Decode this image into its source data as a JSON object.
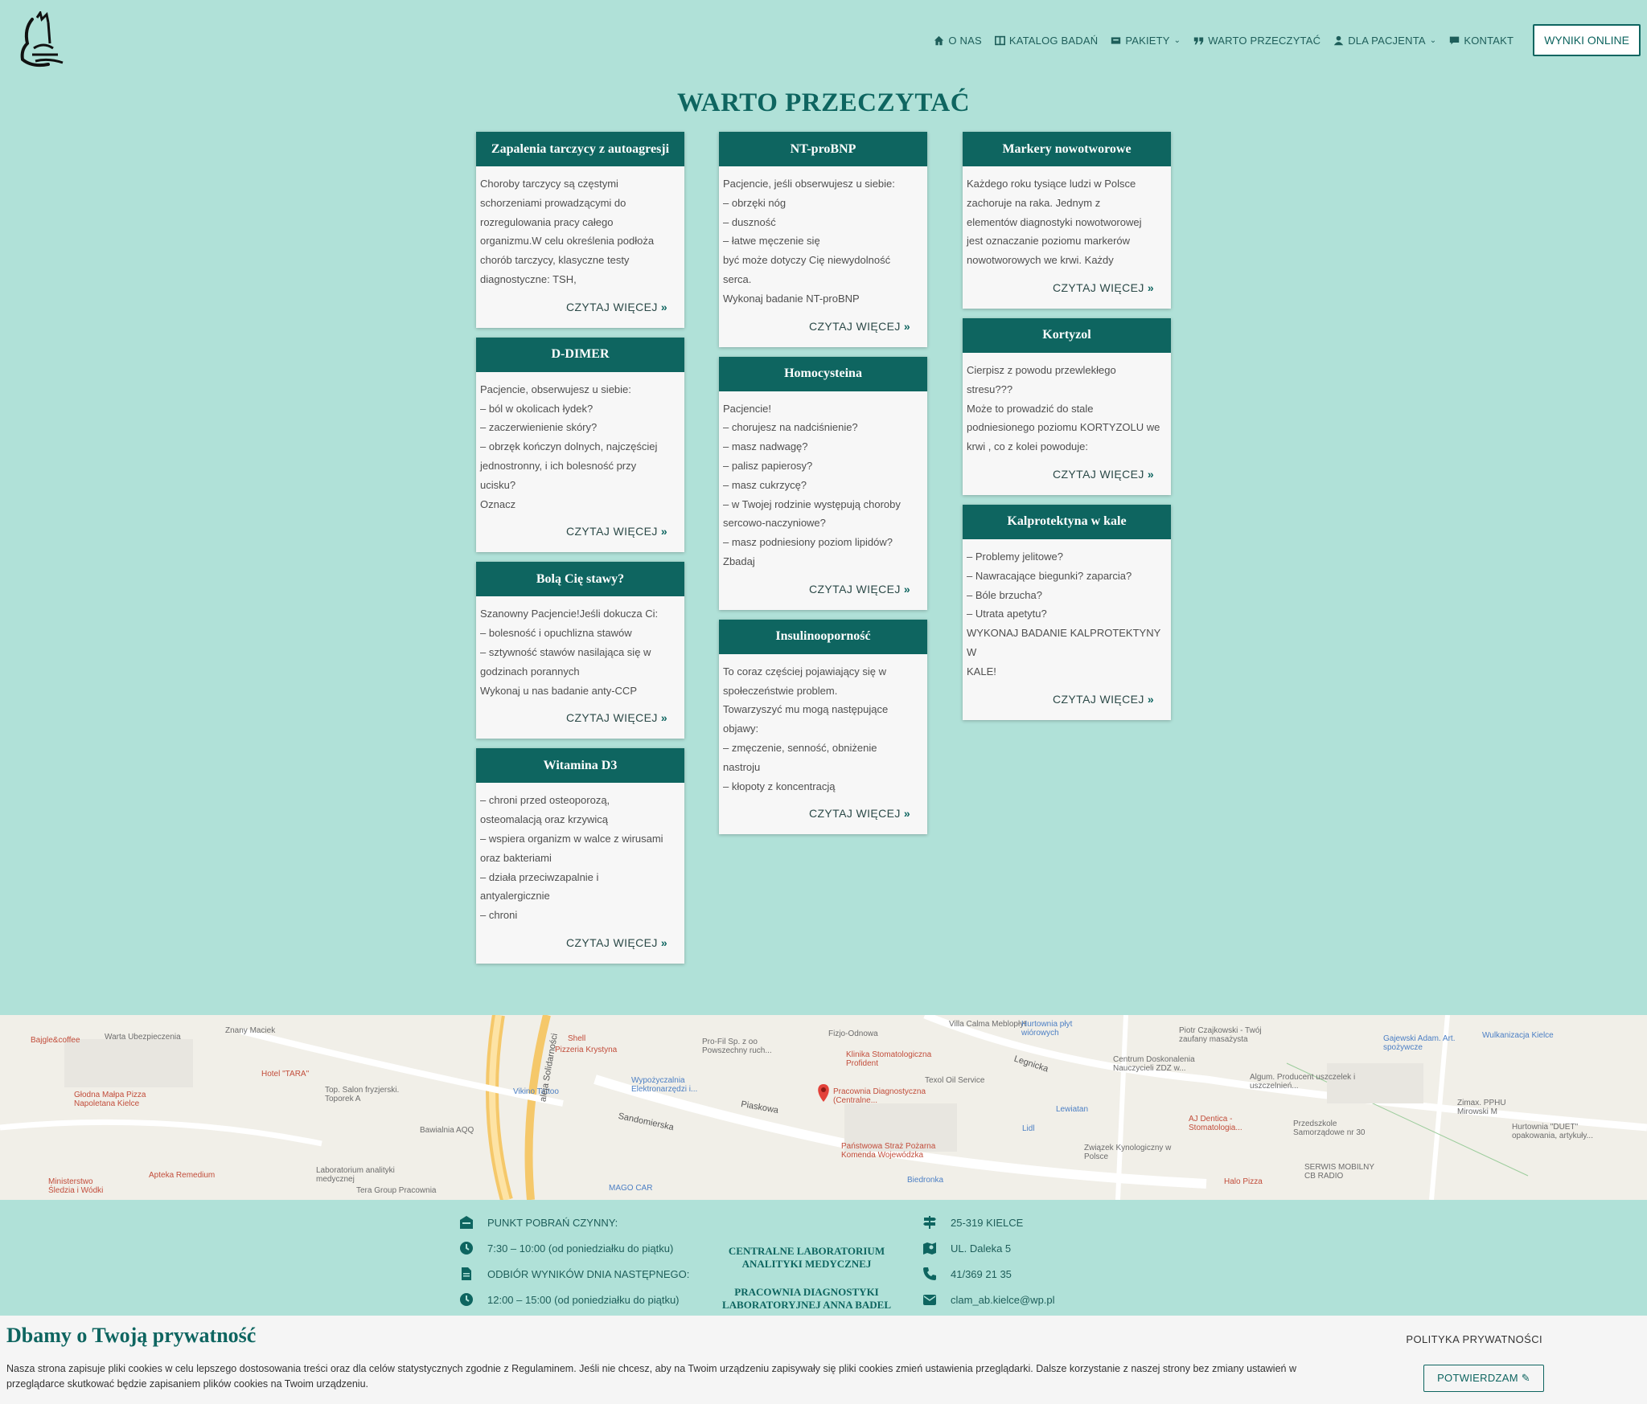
{
  "header": {
    "nav": [
      {
        "label": "O NAS",
        "icon": "home-icon"
      },
      {
        "label": "KATALOG BADAŃ",
        "icon": "book-icon"
      },
      {
        "label": "PAKIETY",
        "icon": "package-icon",
        "dropdown": true
      },
      {
        "label": "WARTO PRZECZYTAĆ",
        "icon": "quote-icon"
      },
      {
        "label": "DLA PACJENTA",
        "icon": "user-icon",
        "dropdown": true
      },
      {
        "label": "KONTAKT",
        "icon": "chat-icon"
      }
    ],
    "results_button": "WYNIKI ONLINE"
  },
  "page_title": "WARTO PRZECZYTAĆ",
  "read_more": "CZYTAJ WIĘCEJ",
  "columns": [
    [
      {
        "title": "Zapalenia tarczycy z autoagresji",
        "lines": [
          "Choroby tarczycy są częstymi",
          "schorzeniami prowadzącymi do",
          "rozregulowania pracy całego",
          "organizmu.W celu określenia podłoża",
          "chorób tarczycy, klasyczne testy",
          "diagnostyczne: TSH,"
        ]
      },
      {
        "title": "D-DIMER",
        "lines": [
          "Pacjencie, obserwujesz u siebie:",
          "– ból w okolicach łydek?",
          "– zaczerwienienie skóry?",
          "– obrzęk kończyn dolnych, najczęściej",
          "jednostronny, i ich bolesność przy",
          "ucisku?",
          "Oznacz"
        ]
      },
      {
        "title": "Bolą Cię stawy?",
        "lines": [
          "Szanowny Pacjencie!Jeśli dokucza Ci:",
          "– bolesność i opuchlizna stawów",
          "– sztywność stawów nasilająca się w",
          "godzinach porannych",
          "Wykonaj u nas badanie anty-CCP"
        ]
      },
      {
        "title": "Witamina D3",
        "lines": [
          "– chroni przed osteoporozą,",
          "osteomalacją oraz krzywicą",
          "– wspiera organizm w walce z wirusami",
          "oraz bakteriami",
          "– działa przeciwzapalnie i",
          "antyalergicznie",
          "– chroni"
        ]
      }
    ],
    [
      {
        "title": "NT-proBNP",
        "lines": [
          "Pacjencie, jeśli obserwujesz u siebie:",
          "– obrzęki nóg",
          "– duszność",
          "– łatwe męczenie się",
          "być może dotyczy Cię niewydolność",
          "serca.",
          "Wykonaj badanie NT-proBNP"
        ]
      },
      {
        "title": "Homocysteina",
        "lines": [
          "Pacjencie!",
          "– chorujesz na nadciśnienie?",
          "– masz nadwagę?",
          "– palisz papierosy?",
          "– masz cukrzycę?",
          "– w Twojej rodzinie występują choroby",
          "sercowo-naczyniowe?",
          "– masz podniesiony poziom lipidów?",
          "Zbadaj"
        ]
      },
      {
        "title": "Insulinooporność",
        "lines": [
          "To coraz częściej pojawiający się w",
          "społeczeństwie problem.",
          "Towarzyszyć mu mogą następujące",
          "objawy:",
          "– zmęczenie, senność, obniżenie",
          "nastroju",
          "– kłopoty z koncentracją"
        ]
      }
    ],
    [
      {
        "title": "Markery nowotworowe",
        "lines": [
          "Każdego roku tysiące ludzi w Polsce",
          "zachoruje na raka. Jednym z",
          "elementów diagnostyki nowotworowej",
          "jest oznaczanie poziomu markerów",
          "nowotworowych we krwi. Każdy"
        ]
      },
      {
        "title": "Kortyzol",
        "lines": [
          "Cierpisz z powodu przewlekłego",
          "stresu???",
          "Może to prowadzić do stale",
          "podniesionego poziomu KORTYZOLU we",
          "krwi , co z kolei powoduje:"
        ]
      },
      {
        "title": "Kalprotektyna w kale",
        "lines": [
          "– Problemy jelitowe?",
          "– Nawracające biegunki? zaparcia?",
          "– Bóle brzucha?",
          "– Utrata apetytu?",
          "WYKONAJ BADANIE KALPROTEKTYNY W",
          "KALE!"
        ]
      }
    ]
  ],
  "map": {
    "labels": [
      {
        "t": "Bajgle&coffee",
        "c": "red"
      },
      {
        "t": "Warta Ubezpieczenia",
        "c": ""
      },
      {
        "t": "Znany Maciek",
        "c": ""
      },
      {
        "t": "Hotel \"TARA\"",
        "c": "red"
      },
      {
        "t": "Głodna Małpa Pizza Napoletana Kielce",
        "c": "red"
      },
      {
        "t": "Top. Salon fryzjerski. Toporek A",
        "c": ""
      },
      {
        "t": "Bawialnia AQQ",
        "c": ""
      },
      {
        "t": "Apteka Remedium",
        "c": "red"
      },
      {
        "t": "Ministerstwo Śledzia i Wódki",
        "c": "red"
      },
      {
        "t": "Laboratorium analityki medycznej",
        "c": ""
      },
      {
        "t": "Tera Group Pracownia",
        "c": ""
      },
      {
        "t": "Shell",
        "c": "red"
      },
      {
        "t": "Pizzeria Krystyna",
        "c": "red"
      },
      {
        "t": "Vikino Tattoo",
        "c": "blue"
      },
      {
        "t": "Wypożyczalnia Elektronarzędzi i...",
        "c": "blue"
      },
      {
        "t": "Pro-Fil Sp. z oo Powszechny ruch...",
        "c": ""
      },
      {
        "t": "Fizjo-Odnowa",
        "c": ""
      },
      {
        "t": "Klinika Stomatologiczna Profident",
        "c": "red"
      },
      {
        "t": "Pracownia Diagnostyczna (Centralne...",
        "c": "red"
      },
      {
        "t": "Texol Oil Service",
        "c": ""
      },
      {
        "t": "Państwowa Straż Pożarna Komenda Wojewódzka",
        "c": "red"
      },
      {
        "t": "Biedronka",
        "c": "blue"
      },
      {
        "t": "Villa Calma Meblopłyt",
        "c": ""
      },
      {
        "t": "Hurtownia płyt wiórowych",
        "c": "blue"
      },
      {
        "t": "Centrum Doskonalenia Nauczycieli ZDZ w...",
        "c": ""
      },
      {
        "t": "Lewiatan",
        "c": "blue"
      },
      {
        "t": "Lidl",
        "c": "blue"
      },
      {
        "t": "Związek Kynologiczny w Polsce",
        "c": ""
      },
      {
        "t": "AJ Dentica - Stomatologia...",
        "c": "red"
      },
      {
        "t": "Piotr Czajkowski - Twój zaufany masażysta",
        "c": ""
      },
      {
        "t": "Algum. Producent uszczelek i uszczelnień...",
        "c": ""
      },
      {
        "t": "Przedszkole Samorządowe nr 30",
        "c": ""
      },
      {
        "t": "SERWIS MOBILNY CB RADIO",
        "c": ""
      },
      {
        "t": "Halo Pizza",
        "c": "red"
      },
      {
        "t": "Gajewski Adam. Art. spożywcze",
        "c": "blue"
      },
      {
        "t": "Wulkanizacja Kielce",
        "c": "blue"
      },
      {
        "t": "Zimax. PPHU Mirowski M",
        "c": ""
      },
      {
        "t": "Hurtownia \"DUET\" opakowania, artykuły...",
        "c": ""
      },
      {
        "t": "MAGO CAR",
        "c": "blue"
      },
      {
        "t": "Sandomierska",
        "c": "street"
      },
      {
        "t": "Piaskowa",
        "c": "street"
      },
      {
        "t": "aleja Solidarności",
        "c": "street"
      },
      {
        "t": "Legnicka",
        "c": "street"
      }
    ]
  },
  "footer": {
    "left": [
      {
        "icon": "building-icon",
        "text": "PUNKT POBRAŃ CZYNNY:"
      },
      {
        "icon": "clock-icon",
        "text": "7:30 – 10:00 (od poniedziałku do piątku)"
      },
      {
        "icon": "document-icon",
        "text": "ODBIÓR WYNIKÓW DNIA NASTĘPNEGO:"
      },
      {
        "icon": "clock-icon",
        "text": "12:00 – 15:00 (od poniedziałku do piątku)"
      }
    ],
    "center": [
      "CENTRALNE LABORATORIUM ANALITYKI MEDYCZNEJ",
      "PRACOWNIA DIAGNOSTYKI LABORATORYJNEJ ANNA BADEL"
    ],
    "right": [
      {
        "icon": "signpost-icon",
        "text": "25-319 KIELCE"
      },
      {
        "icon": "map-pin-icon",
        "text": "UL. Daleka 5"
      },
      {
        "icon": "phone-icon",
        "text": "41/369 21 35"
      },
      {
        "icon": "mail-icon",
        "text": "clam_ab.kielce@wp.pl"
      }
    ]
  },
  "cookie": {
    "title": "Dbamy o Twoją prywatność",
    "text": "Nasza strona zapisuje pliki cookies w celu lepszego dostosowania treści oraz dla celów statystycznych zgodnie z Regulaminem. Jeśli nie chcesz, aby na Twoim urządzeniu zapisywały się pliki cookies zmień ustawienia przeglądarki. Dalsze korzystanie z naszej strony bez zmiany ustawień w przeglądarce skutkować będzie zapisaniem plików cookies na Twoim urządzeniu.",
    "policy": "POLITYKA PRYWATNOŚCI",
    "confirm": "POTWIERDZAM"
  },
  "colors": {
    "accent": "#0e6560",
    "background": "#b0e1d8",
    "card": "#f7f7f7"
  }
}
